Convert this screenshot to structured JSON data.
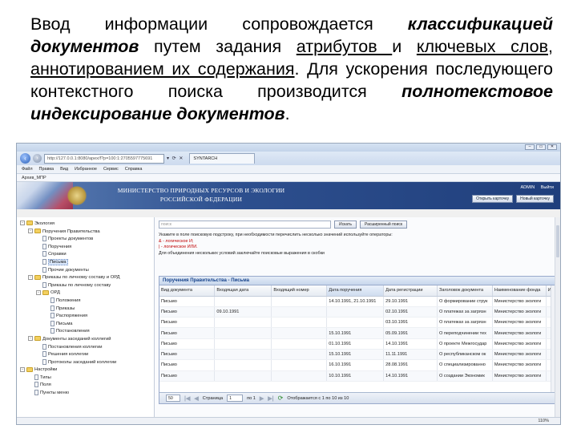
{
  "slide": {
    "t1": "Ввод информации сопровождается ",
    "t2": "классификацией документов",
    "t3": " путем задания ",
    "t4": "атрибутов ",
    "t5": "и ",
    "t6": "ключевых слов",
    "t7": ", ",
    "t8": "аннотированием их содержания",
    "t9": ". Для ускорения последующего контекстного поиска производится ",
    "t10": "полнотекстовое индексирование документов",
    "t11": "."
  },
  "browser": {
    "url": "http://127.0.0.1:8080/apex/f?p=100:1:2705597775691",
    "tab_title": "SYNTARCH",
    "win_controls": [
      "–",
      "▭",
      "✕"
    ],
    "menu": [
      "Файл",
      "Правка",
      "Вид",
      "Избранное",
      "Сервис",
      "Справка"
    ],
    "favorite": "Архив_МПР",
    "status_zoom": "110%"
  },
  "banner": {
    "title": "МИНИСТЕРСТВО ПРИРОДНЫХ РЕСУРСОВ И ЭКОЛОГИИ РОССИЙСКОЙ ФЕДЕРАЦИИ",
    "user": "ADMIN",
    "logout": "Выйти",
    "open_card": "Открыть карточку",
    "new_card": "Новый карточку"
  },
  "tree": [
    {
      "label": "Экология",
      "level": 0,
      "type": "folder",
      "toggle": "-"
    },
    {
      "label": "Поручения Правительства",
      "level": 1,
      "type": "folder",
      "toggle": "-"
    },
    {
      "label": "Проекты документов",
      "level": 2,
      "type": "doc",
      "toggle": ""
    },
    {
      "label": "Поручения",
      "level": 2,
      "type": "doc",
      "toggle": ""
    },
    {
      "label": "Справки",
      "level": 2,
      "type": "doc",
      "toggle": ""
    },
    {
      "label": "Письма",
      "level": 2,
      "type": "doc",
      "toggle": "",
      "selected": true
    },
    {
      "label": "Прочие документы",
      "level": 2,
      "type": "doc",
      "toggle": ""
    },
    {
      "label": "Приказы по личному составу и ОРД",
      "level": 1,
      "type": "folder",
      "toggle": "-"
    },
    {
      "label": "Приказы по личному составу",
      "level": 2,
      "type": "doc",
      "toggle": ""
    },
    {
      "label": "ОРД",
      "level": 2,
      "type": "folder",
      "toggle": "-"
    },
    {
      "label": "Положения",
      "level": 3,
      "type": "doc",
      "toggle": ""
    },
    {
      "label": "Приказы",
      "level": 3,
      "type": "doc",
      "toggle": ""
    },
    {
      "label": "Распоряжения",
      "level": 3,
      "type": "doc",
      "toggle": ""
    },
    {
      "label": "Письма",
      "level": 3,
      "type": "doc",
      "toggle": ""
    },
    {
      "label": "Постановления",
      "level": 3,
      "type": "doc",
      "toggle": ""
    },
    {
      "label": "Документы заседаний коллегий",
      "level": 1,
      "type": "folder",
      "toggle": "-"
    },
    {
      "label": "Постановления коллегии",
      "level": 2,
      "type": "doc",
      "toggle": ""
    },
    {
      "label": "Решения коллегии",
      "level": 2,
      "type": "doc",
      "toggle": ""
    },
    {
      "label": "Протоколы заседаний коллегии",
      "level": 2,
      "type": "doc",
      "toggle": ""
    },
    {
      "label": "Настройки",
      "level": 0,
      "type": "folder",
      "toggle": "-"
    },
    {
      "label": "Типы",
      "level": 1,
      "type": "doc",
      "toggle": ""
    },
    {
      "label": "Поля",
      "level": 1,
      "type": "doc",
      "toggle": ""
    },
    {
      "label": "Пункты меню",
      "level": 1,
      "type": "doc",
      "toggle": ""
    }
  ],
  "search": {
    "placeholder": "поиск",
    "search_btn": "Искать",
    "advanced_btn": "Расширенный поиск",
    "help": [
      "Укажите в поле поисковую подстроку, при необходимости перечислить несколько значений используйте операторы:",
      "& - логическое И;",
      "| - логическое ИЛИ.",
      "Для объединения нескольких условий заключайте поисковые выражения в скобки"
    ]
  },
  "grid": {
    "title": "Поручения Правительства - Письма",
    "columns": [
      "Вид документа",
      "Входящая дата",
      "Входящий номер",
      "Дата поручения",
      "Дата регистрации",
      "Заголовок документа",
      "Наименование фонда",
      "Ис"
    ],
    "rows": [
      [
        "Письмо",
        "",
        "",
        "14.10.1991, 21.10.1991",
        "29.10.1991",
        "О формировании струк",
        "Министерство экологи",
        ""
      ],
      [
        "Письмо",
        "09.10.1991",
        "",
        "",
        "02.10.1991",
        "О платежах за загрязн",
        "Министерство экологи",
        ""
      ],
      [
        "Письмо",
        "",
        "",
        "",
        "03.10.1991",
        "О платежах за загрязн",
        "Министерство экологи",
        ""
      ],
      [
        "Письмо",
        "",
        "",
        "15.10.1991",
        "05.09.1991",
        "О переподчинении тех",
        "Министерство экологи",
        ""
      ],
      [
        "Письмо",
        "",
        "",
        "01.10.1991",
        "14.10.1991",
        "О проекте Межгосудар",
        "Министерство экологи",
        ""
      ],
      [
        "Письмо",
        "",
        "",
        "15.10.1991",
        "11.11.1991",
        "О республиканском ок",
        "Министерство экологи",
        ""
      ],
      [
        "Письмо",
        "",
        "",
        "16.10.1991",
        "28.08.1991",
        "О специализированно",
        "Министерство экологи",
        ""
      ],
      [
        "Письмо",
        "",
        "",
        "10.10.1991",
        "14.10.1991",
        "О создании Экономик",
        "Министерство экологи",
        ""
      ]
    ],
    "page_size": "50",
    "page_label": "Страница",
    "page_value": "1",
    "of_label": "по 1",
    "display_info": "Отображается с 1 по 10 из 10"
  }
}
